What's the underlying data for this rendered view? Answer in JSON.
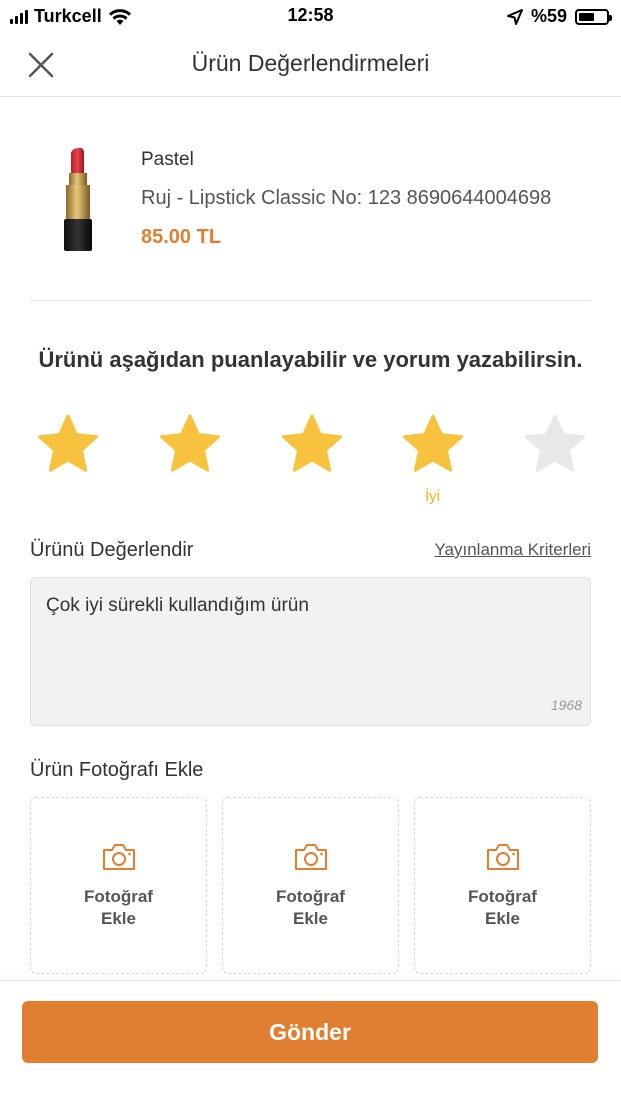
{
  "status_bar": {
    "carrier": "Turkcell",
    "time": "12:58",
    "battery": "%59",
    "battery_level": 0.59
  },
  "header": {
    "title": "Ürün Değerlendirmeleri",
    "close_icon": "close-icon"
  },
  "product": {
    "brand": "Pastel",
    "name": "Ruj - Lipstick Classic No: 123 8690644004698",
    "price": "85.00 TL"
  },
  "prompt": "Ürünü aşağıdan puanlayabilir ve yorum yazabilirsin.",
  "rating": {
    "value": 4,
    "max": 5,
    "label": "İyi",
    "active_color": "#f7c23e",
    "inactive_color": "#e8e8e8"
  },
  "review": {
    "label": "Ürünü Değerlendir",
    "criteria_link": "Yayınlanma Kriterleri",
    "text": "Çok iyi sürekli kullandığım ürün",
    "char_count": "1968"
  },
  "photos": {
    "label": "Ürün Fotoğrafı Ekle",
    "slots": [
      {
        "line1": "Fotoğraf",
        "line2": "Ekle"
      },
      {
        "line1": "Fotoğraf",
        "line2": "Ekle"
      },
      {
        "line1": "Fotoğraf",
        "line2": "Ekle"
      }
    ]
  },
  "submit_label": "Gönder",
  "colors": {
    "accent": "#e07f32",
    "star": "#f7c23e"
  }
}
